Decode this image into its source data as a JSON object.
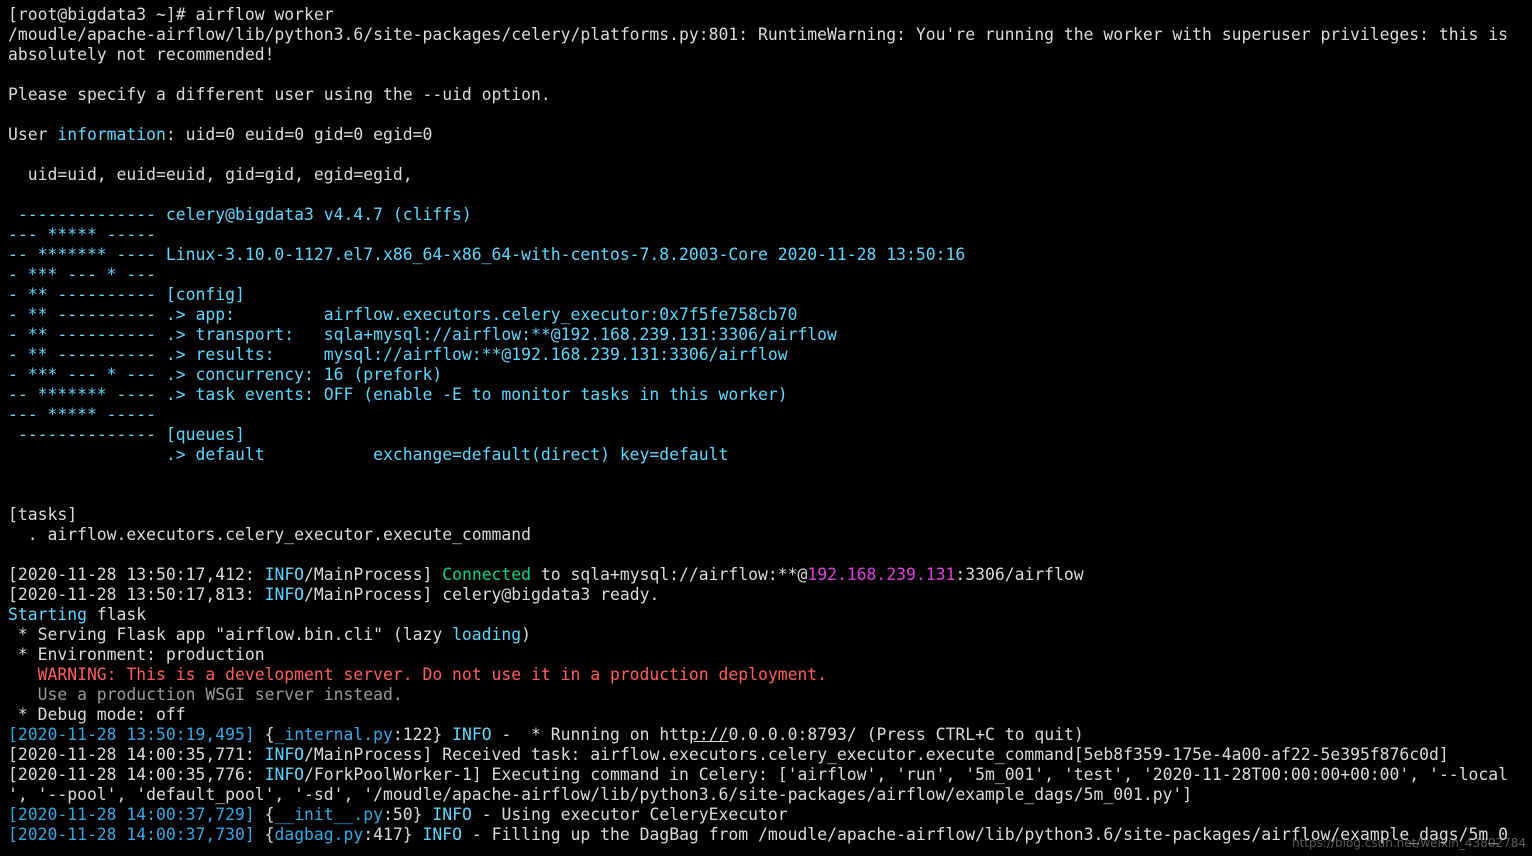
{
  "colors": {
    "background": "#000000",
    "foreground": "#dcdcdc",
    "cyan": "#5fd7ff",
    "blue": "#35a8e6",
    "green": "#00d787",
    "magenta": "#e040e0",
    "red": "#ff5f5f",
    "grey": "#9a9a9a"
  },
  "terminal": {
    "lines": [
      [
        [
          "w",
          "[root@bigdata3 ~]# airflow worker"
        ]
      ],
      [
        [
          "w",
          "/moudle/apache-airflow/lib/python3.6/site-packages/celery/platforms.py:801: RuntimeWarning: You're running the worker with superuser privileges: this is"
        ]
      ],
      [
        [
          "w",
          "absolutely not recommended!"
        ]
      ],
      [],
      [
        [
          "w",
          "Please specify a different user using the --uid option."
        ]
      ],
      [],
      [
        [
          "w",
          "User "
        ],
        [
          "c",
          "information"
        ],
        [
          "w",
          ": uid=0 euid=0 gid=0 egid=0"
        ]
      ],
      [],
      [
        [
          "w",
          "  uid=uid, euid=euid, gid=gid, egid=egid,"
        ]
      ],
      [],
      [
        [
          "c",
          " -------------- celery@bigdata3 v4.4.7 (cliffs)"
        ]
      ],
      [
        [
          "c",
          "--- ***** -----"
        ]
      ],
      [
        [
          "c",
          "-- ******* ---- Linux-3.10.0-1127.el7.x86_64-x86_64-with-centos-7.8.2003-Core 2020-11-28 13:50:16"
        ]
      ],
      [
        [
          "c",
          "- *** --- * ---"
        ]
      ],
      [
        [
          "c",
          "- ** ---------- [config]"
        ]
      ],
      [
        [
          "c",
          "- ** ---------- .> app:         airflow.executors.celery_executor:0x7f5fe758cb70"
        ]
      ],
      [
        [
          "c",
          "- ** ---------- .> transport:   sqla+mysql://airflow:**@192.168.239.131:3306/airflow"
        ]
      ],
      [
        [
          "c",
          "- ** ---------- .> results:     mysql://airflow:**@192.168.239.131:3306/airflow"
        ]
      ],
      [
        [
          "c",
          "- *** --- * --- .> concurrency: 16 (prefork)"
        ]
      ],
      [
        [
          "c",
          "-- ******* ---- .> task events: OFF (enable -E to monitor tasks in this worker)"
        ]
      ],
      [
        [
          "c",
          "--- ***** -----"
        ]
      ],
      [
        [
          "c",
          " -------------- [queues]"
        ]
      ],
      [
        [
          "c",
          "                .> default           exchange=default(direct) key=default"
        ]
      ],
      [],
      [],
      [
        [
          "w",
          "[tasks]"
        ]
      ],
      [
        [
          "w",
          "  . airflow.executors.celery_executor.execute_command"
        ]
      ],
      [],
      [
        [
          "w",
          "[2020-11-28 13:50:17,412: "
        ],
        [
          "c",
          "INFO"
        ],
        [
          "w",
          "/MainProcess] "
        ],
        [
          "g",
          "Connected"
        ],
        [
          "w",
          " to sqla+mysql://airflow:**@"
        ],
        [
          "m",
          "192.168.239.131"
        ],
        [
          "w",
          ":3306/airflow"
        ]
      ],
      [
        [
          "w",
          "[2020-11-28 13:50:17,813: "
        ],
        [
          "c",
          "INFO"
        ],
        [
          "w",
          "/MainProcess] celery@bigdata3 ready."
        ]
      ],
      [
        [
          "c",
          "Starting"
        ],
        [
          "w",
          " flask"
        ]
      ],
      [
        [
          "w",
          " * Serving Flask app \"airflow.bin.cli\" (lazy "
        ],
        [
          "c",
          "loading"
        ],
        [
          "w",
          ")"
        ]
      ],
      [
        [
          "w",
          " * Environment: production"
        ]
      ],
      [
        [
          "r",
          "   WARNING: This is a development server. Do not use it in a production deployment."
        ]
      ],
      [
        [
          "x",
          "   Use a production WSGI server instead."
        ]
      ],
      [
        [
          "w",
          " * Debug mode: off"
        ]
      ],
      [
        [
          "b",
          "[2020-11-28 13:50:19,495]"
        ],
        [
          "w",
          " {"
        ],
        [
          "b",
          "_internal.py"
        ],
        [
          "w",
          ":122} "
        ],
        [
          "c",
          "INFO"
        ],
        [
          "w",
          " -  * Running on htt"
        ],
        [
          "u",
          "p://"
        ],
        [
          "w",
          "0.0.0.0:8793/ (Press CTRL+C to quit)"
        ]
      ],
      [
        [
          "w",
          "[2020-11-28 14:00:35,771: "
        ],
        [
          "c",
          "INFO"
        ],
        [
          "w",
          "/MainProcess] Received task: airflow.executors.celery_executor.execute_command[5eb8f359-175e-4a00-af22-5e395f876c0d]"
        ]
      ],
      [
        [
          "w",
          "[2020-11-28 14:00:35,776: "
        ],
        [
          "c",
          "INFO"
        ],
        [
          "w",
          "/ForkPoolWorker-1] Executing command in Celery: ['airflow', 'run', '5m_001', 'test', '2020-11-28T00:00:00+00:00', '--local"
        ]
      ],
      [
        [
          "w",
          "', '--pool', 'default_pool', '-sd', '/moudle/apache-airflow/lib/python3.6/site-packages/airflow/example_dags/5m_001.py']"
        ]
      ],
      [
        [
          "b",
          "[2020-11-28 14:00:37,729]"
        ],
        [
          "w",
          " {"
        ],
        [
          "b",
          "__init__.py"
        ],
        [
          "w",
          ":50} "
        ],
        [
          "c",
          "INFO"
        ],
        [
          "w",
          " - Using executor CeleryExecutor"
        ]
      ],
      [
        [
          "b",
          "[2020-11-28 14:00:37,730]"
        ],
        [
          "w",
          " {"
        ],
        [
          "b",
          "dagbag.py"
        ],
        [
          "w",
          ":417} "
        ],
        [
          "c",
          "INFO"
        ],
        [
          "w",
          " - Filling up the DagBag from /moudle/apache-airflow/lib/python3.6/site-packages/airflow/example_dags/5m_0"
        ]
      ]
    ]
  },
  "watermark": {
    "text": "https://blog.csdn.net/weixin_43802784"
  }
}
